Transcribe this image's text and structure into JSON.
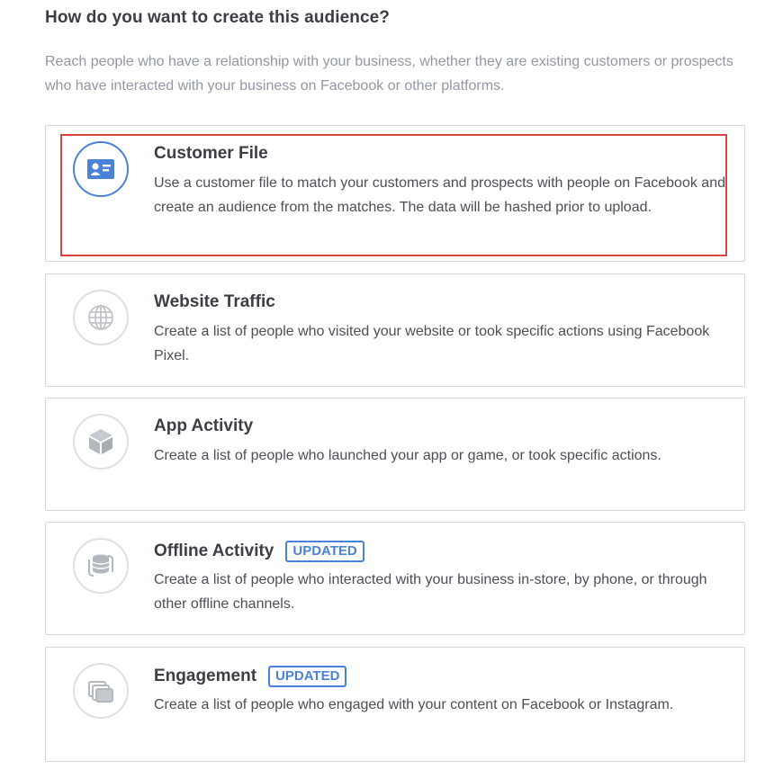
{
  "heading": "How do you want to create this audience?",
  "subtext": "Reach people who have a relationship with your business, whether they are existing customers or prospects who have interacted with your business on Facebook or other platforms.",
  "options": [
    {
      "title": "Customer File",
      "description": "Use a customer file to match your customers and prospects with people on Facebook and create an audience from the matches. The data will be hashed prior to upload.",
      "icon": "id-card-icon",
      "selected": true
    },
    {
      "title": "Website Traffic",
      "description": "Create a list of people who visited your website or took specific actions using Facebook Pixel.",
      "icon": "globe-icon"
    },
    {
      "title": "App Activity",
      "description": "Create a list of people who launched your app or game, or took specific actions.",
      "icon": "cube-icon"
    },
    {
      "title": "Offline Activity",
      "badge": "UPDATED",
      "description": "Create a list of people who interacted with your business in-store, by phone, or through other offline channels.",
      "icon": "database-sync-icon"
    },
    {
      "title": "Engagement",
      "badge": "UPDATED",
      "description": "Create a list of people who engaged with your content on Facebook or Instagram.",
      "icon": "stacked-pages-icon"
    }
  ],
  "colors": {
    "accent": "#4a82d8",
    "highlight": "#d8453e",
    "icon_gray": "#bfc3c9"
  }
}
